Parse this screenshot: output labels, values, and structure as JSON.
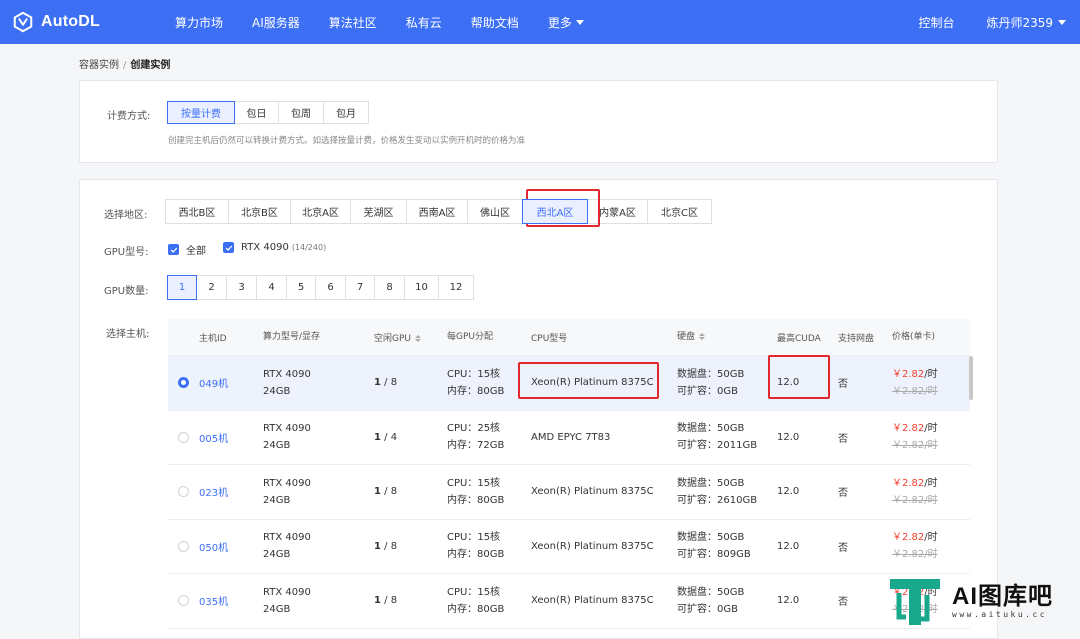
{
  "nav": {
    "brand": "AutoDL",
    "items": [
      "算力市场",
      "AI服务器",
      "算法社区",
      "私有云",
      "帮助文档",
      "更多"
    ],
    "console": "控制台",
    "user": "炼丹师2359"
  },
  "breadcrumb": {
    "parent": "容器实例",
    "separator": "/",
    "current": "创建实例"
  },
  "billing": {
    "label": "计费方式:",
    "options": [
      "按量计费",
      "包日",
      "包周",
      "包月"
    ],
    "selected": "按量计费",
    "hint": "创建完主机后仍然可以转换计费方式。如选择按量计费，价格发生变动以实例开机时的价格为准"
  },
  "region": {
    "label": "选择地区:",
    "options": [
      "西北B区",
      "北京B区",
      "北京A区",
      "芜湖区",
      "西南A区",
      "佛山区",
      "西北A区",
      "内蒙A区",
      "北京C区"
    ],
    "selected": "西北A区"
  },
  "gpu_model": {
    "label": "GPU型号:",
    "all_label": "全部",
    "model_label": "RTX 4090",
    "model_count": "(14/240)"
  },
  "gpu_count": {
    "label": "GPU数量:",
    "options": [
      "1",
      "2",
      "3",
      "4",
      "5",
      "6",
      "7",
      "8",
      "10",
      "12"
    ],
    "selected": "1"
  },
  "host": {
    "label": "选择主机:",
    "columns": [
      "主机ID",
      "算力型号/显存",
      "空闲GPU",
      "每GPU分配",
      "CPU型号",
      "硬盘",
      "最高CUDA",
      "支持网盘",
      "价格(单卡)"
    ],
    "rows": [
      {
        "id": "049机",
        "gpu": "RTX 4090",
        "vram": "24GB",
        "free": "1",
        "total": "8",
        "cpu": "CPU：15核",
        "mem": "内存：80GB",
        "cpu_model": "Xeon(R) Platinum 8375C",
        "disk": "数据盘：50GB",
        "expand": "可扩容：0GB",
        "cuda": "12.0",
        "netdisk": "否",
        "price": "￥2.82",
        "unit": "/时",
        "old_price": "￥2.82/时",
        "selected": true
      },
      {
        "id": "005机",
        "gpu": "RTX 4090",
        "vram": "24GB",
        "free": "1",
        "total": "4",
        "cpu": "CPU：25核",
        "mem": "内存：72GB",
        "cpu_model": "AMD EPYC 7T83",
        "disk": "数据盘：50GB",
        "expand": "可扩容：2011GB",
        "cuda": "12.0",
        "netdisk": "否",
        "price": "￥2.82",
        "unit": "/时",
        "old_price": "￥2.82/时",
        "selected": false
      },
      {
        "id": "023机",
        "gpu": "RTX 4090",
        "vram": "24GB",
        "free": "1",
        "total": "8",
        "cpu": "CPU：15核",
        "mem": "内存：80GB",
        "cpu_model": "Xeon(R) Platinum 8375C",
        "disk": "数据盘：50GB",
        "expand": "可扩容：2610GB",
        "cuda": "12.0",
        "netdisk": "否",
        "price": "￥2.82",
        "unit": "/时",
        "old_price": "￥2.82/时",
        "selected": false
      },
      {
        "id": "050机",
        "gpu": "RTX 4090",
        "vram": "24GB",
        "free": "1",
        "total": "8",
        "cpu": "CPU：15核",
        "mem": "内存：80GB",
        "cpu_model": "Xeon(R) Platinum 8375C",
        "disk": "数据盘：50GB",
        "expand": "可扩容：809GB",
        "cuda": "12.0",
        "netdisk": "否",
        "price": "￥2.82",
        "unit": "/时",
        "old_price": "￥2.82/时",
        "selected": false
      },
      {
        "id": "035机",
        "gpu": "RTX 4090",
        "vram": "24GB",
        "free": "1",
        "total": "8",
        "cpu": "CPU：15核",
        "mem": "内存：80GB",
        "cpu_model": "Xeon(R) Platinum 8375C",
        "disk": "数据盘：50GB",
        "expand": "可扩容：0GB",
        "cuda": "12.0",
        "netdisk": "否",
        "price": "￥2.82",
        "unit": "/时",
        "old_price": "￥2.82/时",
        "selected": false
      }
    ]
  },
  "watermark": {
    "title": "AI图库吧",
    "url": "www.aituku.cc"
  },
  "colors": {
    "primary": "#3d6ff5",
    "highlight": "#e0282e",
    "price": "#f2402f"
  }
}
